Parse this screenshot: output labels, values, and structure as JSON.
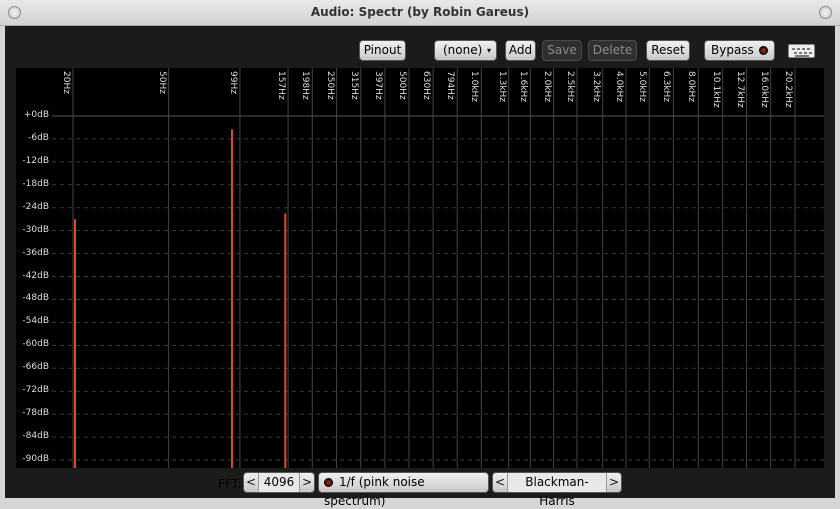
{
  "window": {
    "title": "Audio: Spectr (by Robin Gareus)"
  },
  "toolbar": {
    "pinout": "Pinout",
    "preset": "(none)",
    "add": "Add",
    "save": "Save",
    "delete": "Delete",
    "reset": "Reset",
    "bypass": "Bypass"
  },
  "colors": {
    "peak": "#e04a2a",
    "grid": "#3c3c3c",
    "plot_bg": "#000000"
  },
  "chart_data": {
    "type": "bar",
    "x_ticks": [
      "20Hz",
      "50Hz",
      "99Hz",
      "157Hz",
      "198Hz",
      "250Hz",
      "315Hz",
      "397Hz",
      "500Hz",
      "630Hz",
      "794Hz",
      "1.0kHz",
      "1.3kHz",
      "1.6kHz",
      "2.0kHz",
      "2.5kHz",
      "3.2kHz",
      "4.0kHz",
      "5.0kHz",
      "6.3kHz",
      "8.0kHz",
      "10.1kHz",
      "12.7kHz",
      "16.0kHz",
      "20.2kHz"
    ],
    "y_ticks": [
      "+0dB",
      "-6dB",
      "-12dB",
      "-18dB",
      "-24dB",
      "-30dB",
      "-36dB",
      "-42dB",
      "-48dB",
      "-54dB",
      "-60dB",
      "-66dB",
      "-72dB",
      "-78dB",
      "-84dB",
      "-90dB"
    ],
    "ylim": [
      -90,
      0
    ],
    "peaks": [
      {
        "freq_hz": 20,
        "db": -27
      },
      {
        "freq_hz": 90,
        "db": -3.5
      },
      {
        "freq_hz": 150,
        "db": -25.5
      }
    ],
    "grid": true
  },
  "footer": {
    "fft_label": "FFT:",
    "fft_size": "4096",
    "weighting": "1/f (pink noise spectrum)",
    "window_fn": "Blackman-Harris",
    "left_arrow": "<",
    "right_arrow": ">"
  }
}
